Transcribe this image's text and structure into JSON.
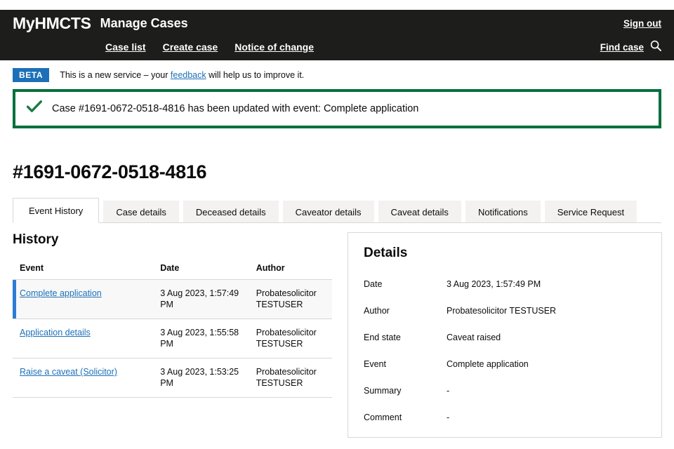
{
  "header": {
    "brand": "MyHMCTS",
    "service_name": "Manage Cases",
    "sign_out": "Sign out",
    "nav": [
      {
        "label": "Case list"
      },
      {
        "label": "Create case"
      },
      {
        "label": "Notice of change"
      }
    ],
    "find_case": "Find case",
    "search_icon": "search-icon",
    "background_color": "#1d1d1b"
  },
  "phase_banner": {
    "tag": "BETA",
    "tag_color": "#1d70b8",
    "text_before": "This is a new service – your ",
    "link": "feedback",
    "text_after": " will help us to improve it."
  },
  "success_banner": {
    "icon": "check-icon",
    "border_color": "#00703c",
    "message": "Case #1691-0672-0518-4816 has been updated with event: Complete application"
  },
  "case": {
    "reference_heading": "#1691-0672-0518-4816"
  },
  "tabs": [
    {
      "label": "Event History",
      "active": true
    },
    {
      "label": "Case details",
      "active": false
    },
    {
      "label": "Deceased details",
      "active": false
    },
    {
      "label": "Caveator details",
      "active": false
    },
    {
      "label": "Caveat details",
      "active": false
    },
    {
      "label": "Notifications",
      "active": false
    },
    {
      "label": "Service Request",
      "active": false
    }
  ],
  "history": {
    "title": "History",
    "columns": [
      "Event",
      "Date",
      "Author"
    ],
    "rows": [
      {
        "event": "Complete application",
        "date": "3 Aug 2023, 1:57:49 PM",
        "author": "Probatesolicitor TESTUSER",
        "selected": true
      },
      {
        "event": "Application details",
        "date": "3 Aug 2023, 1:55:58 PM",
        "author": "Probatesolicitor TESTUSER",
        "selected": false
      },
      {
        "event": "Raise a caveat (Solicitor)",
        "date": "3 Aug 2023, 1:53:25 PM",
        "author": "Probatesolicitor TESTUSER",
        "selected": false
      }
    ],
    "selected_row_accent": "#2b7cd3"
  },
  "details": {
    "title": "Details",
    "fields": [
      {
        "label": "Date",
        "value": "3 Aug 2023, 1:57:49 PM"
      },
      {
        "label": "Author",
        "value": "Probatesolicitor TESTUSER"
      },
      {
        "label": "End state",
        "value": "Caveat raised"
      },
      {
        "label": "Event",
        "value": "Complete application"
      },
      {
        "label": "Summary",
        "value": "-"
      },
      {
        "label": "Comment",
        "value": "-"
      }
    ]
  }
}
